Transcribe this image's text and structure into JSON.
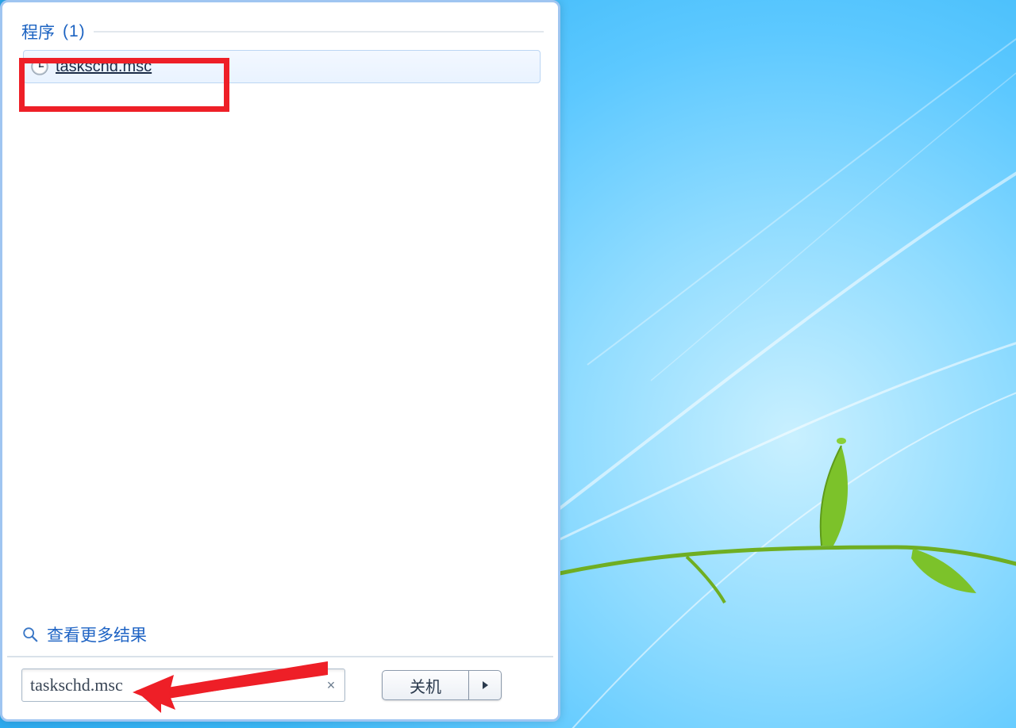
{
  "search": {
    "group_label": "程序",
    "group_count": "(1)",
    "result_label": "taskschd.msc",
    "more_results_label": "查看更多结果",
    "input_value": "taskschd.msc",
    "clear_glyph": "×"
  },
  "footer": {
    "shutdown_label": "关机"
  },
  "icons": {
    "result_icon": "clock-icon",
    "search_icon": "magnifier-icon",
    "shutdown_menu_icon": "triangle-right-icon"
  }
}
